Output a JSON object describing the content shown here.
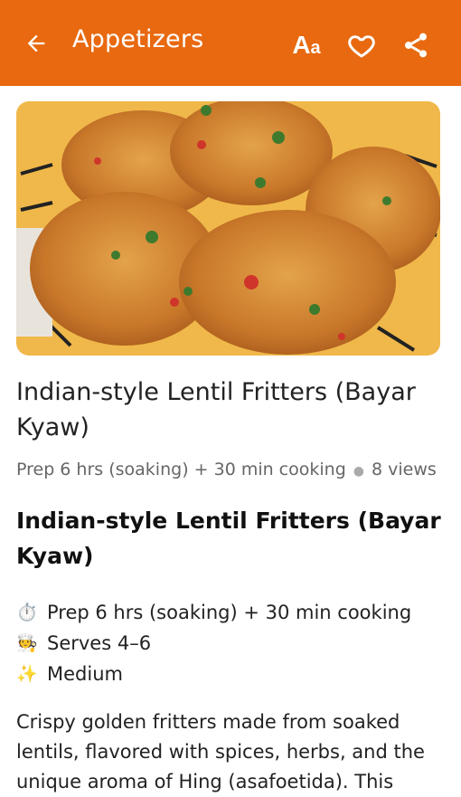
{
  "appbar": {
    "title": "Appetizers",
    "back_icon": "arrow-left-icon",
    "font_size_label_big": "A",
    "font_size_label_small": "a",
    "favorite_icon": "heart-outline-icon",
    "share_icon": "share-icon",
    "background": "#e8690f"
  },
  "hero": {
    "image": "lentil-fritters-in-basket-photo"
  },
  "recipe": {
    "title": "Indian-style Lentil Fritters (Bayar Kyaw)",
    "time": "Prep 6 hrs (soaking) + 30 min cooking",
    "views": "8 views",
    "heading": "Indian-style Lentil Fritters (Bayar Kyaw)",
    "facts": [
      {
        "icon": "stopwatch-icon",
        "glyph": "⏱️",
        "text": "Prep 6 hrs (soaking) + 30 min cooking"
      },
      {
        "icon": "cook-icon",
        "glyph": "🧑‍🍳",
        "text": "Serves 4–6"
      },
      {
        "icon": "sparkles-icon",
        "glyph": "✨",
        "text": "Medium"
      }
    ],
    "description": "Crispy golden fritters made from soaked lentils, flavored with spices, herbs, and the unique aroma of Hing (asafoetida). This"
  }
}
